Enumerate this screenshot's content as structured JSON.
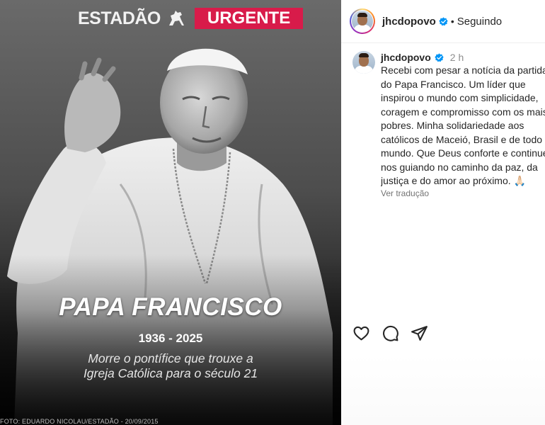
{
  "post_image": {
    "brand": "ESTADÃO",
    "badge": "URGENTE",
    "headline": "PAPA FRANCISCO",
    "years": "1936 - 2025",
    "subheadline_lines": [
      "Morre o pontífice que trouxe a",
      "Igreja Católica para o século 21"
    ],
    "photo_credit": "FOTO: EDUARDO NICOLAU/ESTADÃO - 20/09/2015",
    "badge_color": "#d81b4a"
  },
  "header": {
    "username": "jhcdopovo",
    "separator": "•",
    "follow_status": "Seguindo",
    "verified_color": "#0095f6"
  },
  "caption": {
    "username": "jhcdopovo",
    "time": "2 h",
    "lines": [
      "Recebi com pesar a notícia da partida",
      "do Papa Francisco. Um líder que",
      "inspirou o mundo com simplicidade,",
      "coragem e compromisso com os mais",
      "pobres. Minha solidariedade aos",
      "católicos de Maceió, Brasil e de todo o",
      "mundo. Que Deus conforte e continue",
      "nos guiando no caminho da paz, da",
      "justiça e do amor ao próximo. 🙏🏻"
    ],
    "translate_label": "Ver tradução"
  },
  "actions": {
    "icons": [
      "heart-icon",
      "comment-icon",
      "share-icon"
    ]
  }
}
